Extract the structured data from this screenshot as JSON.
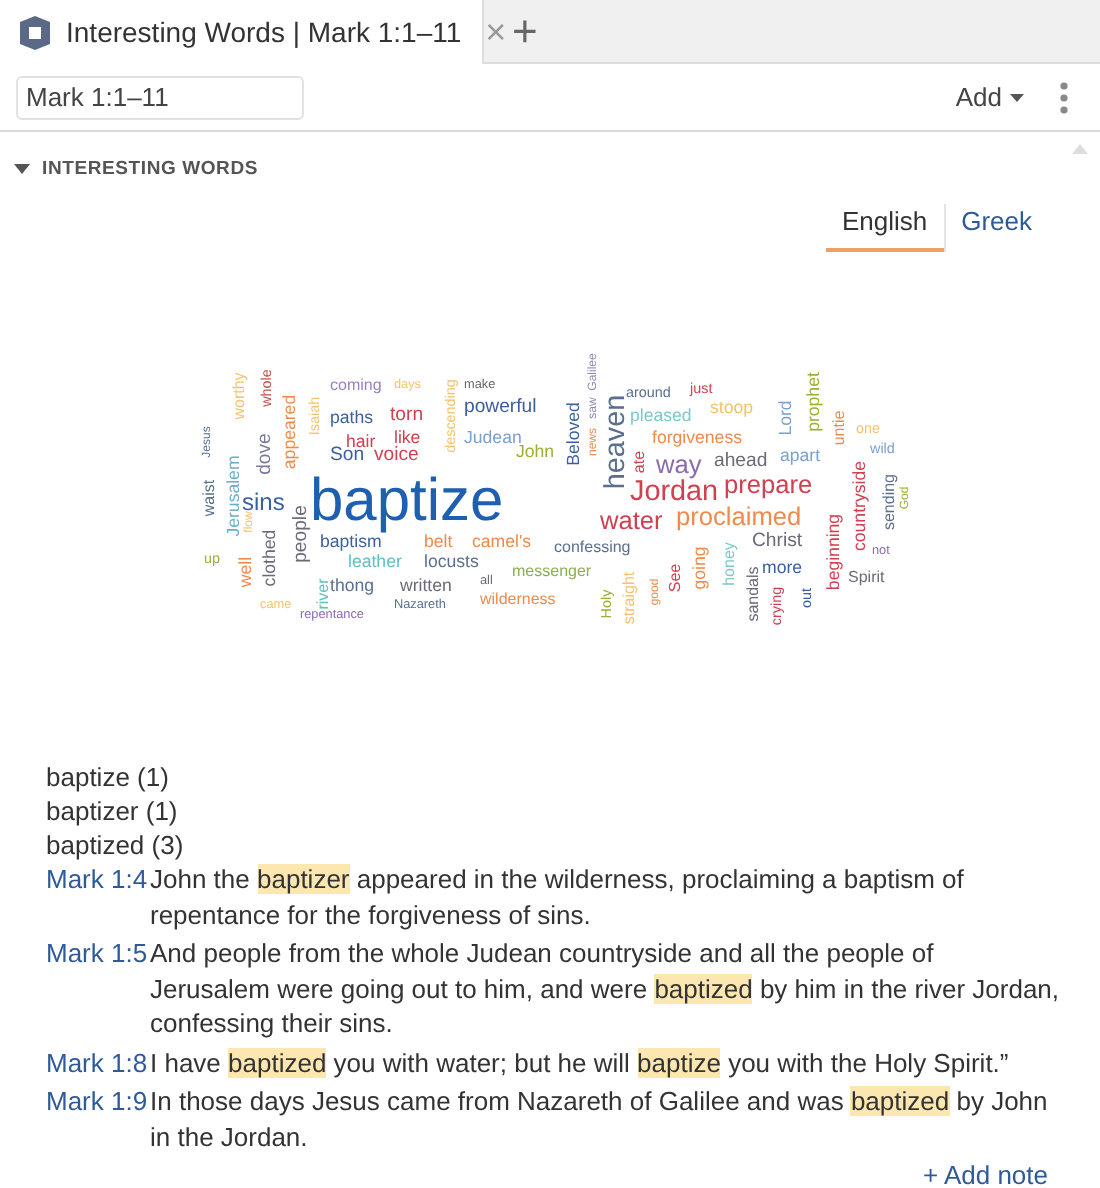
{
  "tab": {
    "title": "Interesting Words | Mark 1:1–11",
    "close": "×"
  },
  "new_tab": "+",
  "toolbar": {
    "reference": "Mark 1:1–11",
    "add_button": "Add"
  },
  "section": {
    "title": "INTERESTING WORDS",
    "expanded": true
  },
  "language_tabs": [
    {
      "label": "English",
      "selected": true
    },
    {
      "label": "Greek",
      "selected": false
    }
  ],
  "word_cloud": [
    {
      "text": "coming",
      "color": "#9b7fc0",
      "vertical": false
    },
    {
      "text": "days",
      "color": "#f5c26b",
      "vertical": false
    },
    {
      "text": "make",
      "color": "#666666",
      "vertical": false
    },
    {
      "text": "worthy",
      "color": "#f5c26b",
      "vertical": true
    },
    {
      "text": "whole",
      "color": "#c0504d",
      "vertical": true
    },
    {
      "text": "Isaiah",
      "color": "#f5c26b",
      "vertical": true
    },
    {
      "text": "descending",
      "color": "#f5c26b",
      "vertical": true
    },
    {
      "text": "paths",
      "color": "#3a5fa0",
      "vertical": false
    },
    {
      "text": "torn",
      "color": "#d04050",
      "vertical": false
    },
    {
      "text": "powerful",
      "color": "#3a5fa0",
      "vertical": false
    },
    {
      "text": "Jesus",
      "color": "#5a6e90",
      "vertical": true
    },
    {
      "text": "hair",
      "color": "#d04050",
      "vertical": false
    },
    {
      "text": "like",
      "color": "#d04050",
      "vertical": false
    },
    {
      "text": "Judean",
      "color": "#7aa0d0",
      "vertical": false
    },
    {
      "text": "dove",
      "color": "#7a7a9a",
      "vertical": true
    },
    {
      "text": "appeared",
      "color": "#f08a4b",
      "vertical": true
    },
    {
      "text": "Son",
      "color": "#3a5fa0",
      "vertical": false
    },
    {
      "text": "voice",
      "color": "#d04050",
      "vertical": false
    },
    {
      "text": "John",
      "color": "#9ab030",
      "vertical": false
    },
    {
      "text": "Beloved",
      "color": "#3a5fa0",
      "vertical": true
    },
    {
      "text": "Galilee",
      "color": "#8a8ab0",
      "vertical": true
    },
    {
      "text": "saw",
      "color": "#8a8ab0",
      "vertical": true
    },
    {
      "text": "news",
      "color": "#f08a4b",
      "vertical": true
    },
    {
      "text": "heaven",
      "color": "#5a6e90",
      "vertical": true
    },
    {
      "text": "around",
      "color": "#5a6e90",
      "vertical": false
    },
    {
      "text": "just",
      "color": "#d04050",
      "vertical": false
    },
    {
      "text": "pleased",
      "color": "#7ac8c8",
      "vertical": false
    },
    {
      "text": "stoop",
      "color": "#f5c26b",
      "vertical": false
    },
    {
      "text": "Lord",
      "color": "#7aa0d0",
      "vertical": true
    },
    {
      "text": "prophet",
      "color": "#9ab030",
      "vertical": true
    },
    {
      "text": "untie",
      "color": "#f08a4b",
      "vertical": true
    },
    {
      "text": "one",
      "color": "#f5c26b",
      "vertical": false
    },
    {
      "text": "forgiveness",
      "color": "#f08a4b",
      "vertical": false
    },
    {
      "text": "wild",
      "color": "#7aa0d0",
      "vertical": false
    },
    {
      "text": "ate",
      "color": "#d04050",
      "vertical": true
    },
    {
      "text": "way",
      "color": "#8a6ab0",
      "vertical": false
    },
    {
      "text": "ahead",
      "color": "#6a6a7a",
      "vertical": false
    },
    {
      "text": "apart",
      "color": "#7aa0d0",
      "vertical": false
    },
    {
      "text": "countryside",
      "color": "#d04050",
      "vertical": true
    },
    {
      "text": "sending",
      "color": "#5a6e90",
      "vertical": true
    },
    {
      "text": "God",
      "color": "#9ab030",
      "vertical": true
    },
    {
      "text": "waist",
      "color": "#5a6e90",
      "vertical": true
    },
    {
      "text": "Jerusalem",
      "color": "#6aaed0",
      "vertical": true
    },
    {
      "text": "sins",
      "color": "#3a5fa0",
      "vertical": false
    },
    {
      "text": "baptize",
      "color": "#1f5fb0",
      "vertical": false
    },
    {
      "text": "flow",
      "color": "#f5c26b",
      "vertical": true
    },
    {
      "text": "people",
      "color": "#6a6a7a",
      "vertical": true
    },
    {
      "text": "Jordan",
      "color": "#d04050",
      "vertical": false
    },
    {
      "text": "prepare",
      "color": "#d04050",
      "vertical": false
    },
    {
      "text": "water",
      "color": "#d04050",
      "vertical": false
    },
    {
      "text": "proclaimed",
      "color": "#f08a4b",
      "vertical": false
    },
    {
      "text": "baptism",
      "color": "#3a5fa0",
      "vertical": false
    },
    {
      "text": "belt",
      "color": "#f08a4b",
      "vertical": false
    },
    {
      "text": "camel's",
      "color": "#f08a4b",
      "vertical": false
    },
    {
      "text": "beginning",
      "color": "#d04050",
      "vertical": true
    },
    {
      "text": "confessing",
      "color": "#5a6e90",
      "vertical": false
    },
    {
      "text": "Christ",
      "color": "#6a6a7a",
      "vertical": false
    },
    {
      "text": "not",
      "color": "#8a6ab0",
      "vertical": false
    },
    {
      "text": "up",
      "color": "#9ab030",
      "vertical": false
    },
    {
      "text": "clothed",
      "color": "#6a6a7a",
      "vertical": true
    },
    {
      "text": "well",
      "color": "#f08a4b",
      "vertical": true
    },
    {
      "text": "leather",
      "color": "#60c0c0",
      "vertical": false
    },
    {
      "text": "locusts",
      "color": "#5a6e90",
      "vertical": false
    },
    {
      "text": "messenger",
      "color": "#8ab04a",
      "vertical": false
    },
    {
      "text": "See",
      "color": "#d04050",
      "vertical": true
    },
    {
      "text": "going",
      "color": "#f08a4b",
      "vertical": true
    },
    {
      "text": "honey",
      "color": "#7ac8c8",
      "vertical": true
    },
    {
      "text": "more",
      "color": "#3a5fa0",
      "vertical": false
    },
    {
      "text": "Spirit",
      "color": "#6a6a7a",
      "vertical": false
    },
    {
      "text": "river",
      "color": "#60c0c0",
      "vertical": true
    },
    {
      "text": "thong",
      "color": "#5a6e90",
      "vertical": false
    },
    {
      "text": "written",
      "color": "#6a6a7a",
      "vertical": false
    },
    {
      "text": "all",
      "color": "#6a6a7a",
      "vertical": false
    },
    {
      "text": "came",
      "color": "#f5c26b",
      "vertical": false
    },
    {
      "text": "Nazareth",
      "color": "#5a6e90",
      "vertical": false
    },
    {
      "text": "wilderness",
      "color": "#f08a4b",
      "vertical": false
    },
    {
      "text": "repentance",
      "color": "#8a6ab0",
      "vertical": false
    },
    {
      "text": "Holy",
      "color": "#9ab030",
      "vertical": true
    },
    {
      "text": "straight",
      "color": "#f5c26b",
      "vertical": true
    },
    {
      "text": "good",
      "color": "#f08a4b",
      "vertical": true
    },
    {
      "text": "sandals",
      "color": "#6a6a7a",
      "vertical": true
    },
    {
      "text": "crying",
      "color": "#d04050",
      "vertical": true
    },
    {
      "text": "out",
      "color": "#3a5fa0",
      "vertical": true
    }
  ],
  "word_counts": [
    "baptize (1)",
    "baptizer (1)",
    "baptized (3)"
  ],
  "verses": [
    {
      "reference": "Mark 1:4",
      "text": "John the **baptizer** appeared in the wilderness, proclaiming a baptism of repentance for the forgiveness of sins."
    },
    {
      "reference": "Mark 1:5",
      "text": "And people from the whole Judean countryside and all the people of Jerusalem were going out to him, and were **baptized** by him in the river Jordan, confessing their sins."
    },
    {
      "reference": "Mark 1:8",
      "text": "I have **baptized** you with water; but he will **baptize** you with the Holy Spirit.”"
    },
    {
      "reference": "Mark 1:9",
      "text": "In those days Jesus came from Nazareth of Galilee and was **baptized** by John in the Jordan."
    }
  ],
  "add_note": "+ Add note"
}
